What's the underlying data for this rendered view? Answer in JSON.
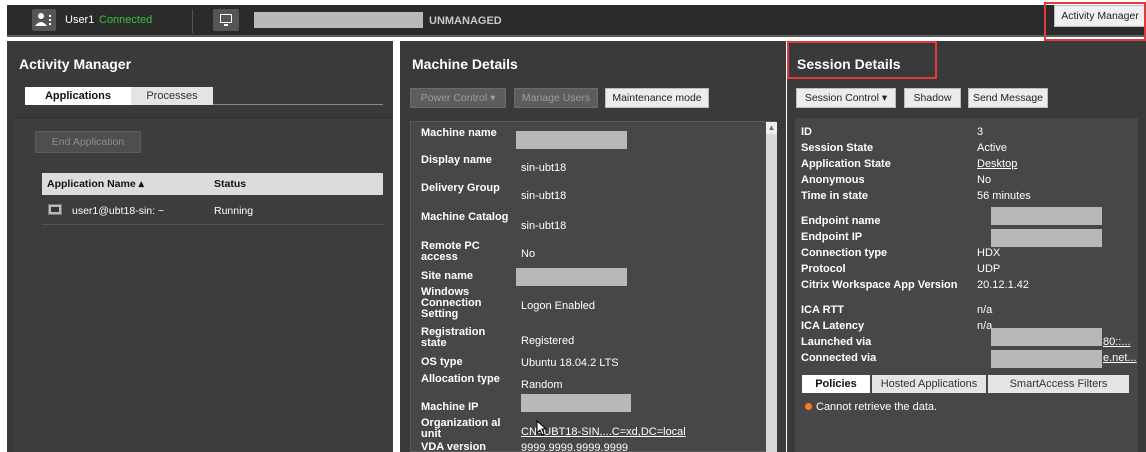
{
  "topbar": {
    "user_name": "User1",
    "user_status": "Connected",
    "machine_state": "UNMANAGED",
    "activity_manager_button": "Activity Manager"
  },
  "activity_manager": {
    "title": "Activity Manager",
    "tabs": [
      "Applications",
      "Processes"
    ],
    "end_application_button": "End Application",
    "columns": {
      "name": "Application Name ▴",
      "status": "Status"
    },
    "rows": [
      {
        "name": "user1@ubt18-sin: ~",
        "status": "Running"
      }
    ]
  },
  "machine_details": {
    "title": "Machine Details",
    "buttons": {
      "power_control": "Power Control ▾",
      "manage_users": "Manage Users",
      "maintenance_mode": "Maintenance mode"
    },
    "rows": [
      {
        "label": "Machine name",
        "value": ""
      },
      {
        "label": "Display name",
        "value": "sin-ubt18"
      },
      {
        "label": "Delivery Group",
        "value": "sin-ubt18"
      },
      {
        "label": "Machine Catalog",
        "value": "sin-ubt18"
      },
      {
        "label": "Remote PC access",
        "value": "No"
      },
      {
        "label": "Site name",
        "value": ""
      },
      {
        "label": "Windows Connection Setting",
        "value": "Logon Enabled"
      },
      {
        "label": "Registration state",
        "value": "Registered"
      },
      {
        "label": "OS type",
        "value": "Ubuntu 18.04.2 LTS"
      },
      {
        "label": "Allocation type",
        "value": "Random"
      },
      {
        "label": "Machine IP",
        "value": ""
      },
      {
        "label": "Organization al unit",
        "value": "CN=UBT18-SIN,...C=xd,DC=local"
      },
      {
        "label": "VDA version",
        "value": "9999.9999.9999.9999"
      }
    ]
  },
  "session_details": {
    "title": "Session Details",
    "buttons": {
      "session_control": "Session Control ▾",
      "shadow": "Shadow",
      "send_message": "Send Message"
    },
    "rows": [
      {
        "label": "ID",
        "value": "3"
      },
      {
        "label": "Session State",
        "value": "Active"
      },
      {
        "label": "Application State",
        "value": "Desktop"
      },
      {
        "label": "Anonymous",
        "value": "No"
      },
      {
        "label": "Time in state",
        "value": "56 minutes"
      },
      {
        "label": "Endpoint name",
        "value": ""
      },
      {
        "label": "Endpoint IP",
        "value": ""
      },
      {
        "label": "Connection type",
        "value": "HDX"
      },
      {
        "label": "Protocol",
        "value": "UDP"
      },
      {
        "label": "Citrix Workspace App Version",
        "value": "20.12.1.42"
      },
      {
        "label": "ICA RTT",
        "value": "n/a"
      },
      {
        "label": "ICA Latency",
        "value": "n/a"
      },
      {
        "label": "Launched via",
        "value": "80::..."
      },
      {
        "label": "Connected via",
        "value": "e.net..."
      }
    ],
    "subtabs": [
      "Policies",
      "Hosted Applications",
      "SmartAccess Filters"
    ],
    "error_message": "Cannot retrieve the data."
  },
  "colors": {
    "panel_bg": "#3a3a3a",
    "connected_green": "#39c139",
    "highlight_red": "#e03a3a",
    "error_orange": "#ff7a1a"
  },
  "icons": [
    "user-icon",
    "monitor-icon",
    "terminal-icon",
    "error-icon",
    "mouse-cursor-icon"
  ]
}
